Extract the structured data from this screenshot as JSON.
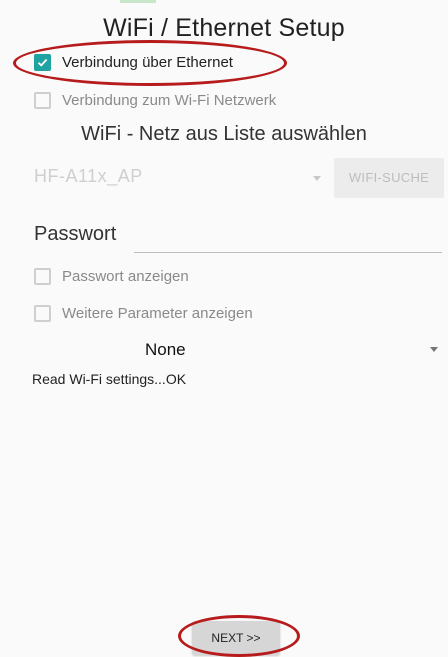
{
  "header": {
    "title": "WiFi / Ethernet Setup"
  },
  "options": {
    "ethernet": {
      "label": "Verbindung über Ethernet",
      "checked": true
    },
    "wifi": {
      "label": "Verbindung zum Wi-Fi Netzwerk",
      "checked": false
    }
  },
  "network": {
    "heading": "WiFi - Netz aus Liste auswählen",
    "selected_ssid": "HF-A11x_AP",
    "search_button": "WIFI-SUCHE"
  },
  "password": {
    "label": "Passwort",
    "value": ""
  },
  "checkboxes": {
    "show_password": "Passwort anzeigen",
    "more_params": "Weitere Parameter anzeigen"
  },
  "mode": {
    "selected": "None"
  },
  "status": {
    "message": "Read Wi-Fi settings...OK"
  },
  "footer": {
    "next_label": "NEXT >>"
  },
  "colors": {
    "accent": "#1ea3a0",
    "annotation": "#b71c1c"
  }
}
